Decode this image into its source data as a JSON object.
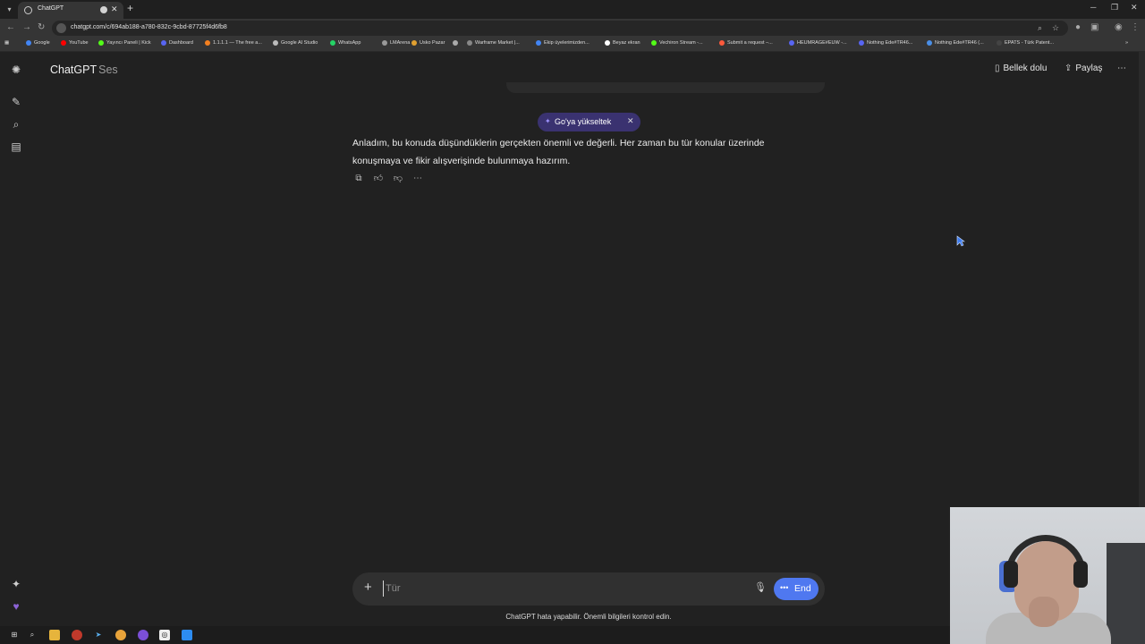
{
  "browser": {
    "tab_title": "ChatGPT",
    "url": "chatgpt.com/c/694ab188-a780-832c-9cbd-87725f4d6fb8",
    "bookmarks": [
      {
        "label": "Google",
        "color": "#4285f4"
      },
      {
        "label": "YouTube",
        "color": "#ff0000"
      },
      {
        "label": "Yayıncı Paneli | Kick",
        "color": "#53fc18"
      },
      {
        "label": "Dashboard",
        "color": "#5865f2"
      },
      {
        "label": "1.1.1.1 — The free a...",
        "color": "#f38020"
      },
      {
        "label": "Google AI Studio",
        "color": "#bbbbbb"
      },
      {
        "label": "WhatsApp",
        "color": "#25d366"
      },
      {
        "label": "LMArena",
        "color": "#999999"
      },
      {
        "label": "Usko Pazar",
        "color": "#e0a030"
      },
      {
        "label": "",
        "color": "#aaaaaa"
      },
      {
        "label": "Warframe Market |...",
        "color": "#888888"
      },
      {
        "label": "Ekip üyelerimizden...",
        "color": "#4285f4"
      },
      {
        "label": "Beyaz ekran",
        "color": "#ffffff"
      },
      {
        "label": "Vechiron Stream -...",
        "color": "#53fc18"
      },
      {
        "label": "Submit a request –...",
        "color": "#ff5a3c"
      },
      {
        "label": "HEUMRAGE#EUW -...",
        "color": "#5865f2"
      },
      {
        "label": "Nothing Ede#TR46...",
        "color": "#5865f2"
      },
      {
        "label": "Nothing Ede#TR46 (...",
        "color": "#4a8fe7"
      },
      {
        "label": "EPATS - Türk Patent...",
        "color": "#444444"
      }
    ]
  },
  "header": {
    "title": "ChatGPT",
    "mode": "Ses",
    "upgrade_label": "Go'ya yükseltek",
    "memory_label": "Bellek dolu",
    "share_label": "Paylaş"
  },
  "conversation": {
    "assistant_message": "Anladım, bu konuda düşündüklerin gerçekten önemli ve değerli. Her zaman bu tür konular üzerinde konuşmaya ve fikir alışverişinde bulunmaya hazırım."
  },
  "composer": {
    "placeholder": "Tür",
    "end_label": "End"
  },
  "footer": {
    "disclaimer": "ChatGPT hata yapabilir. Önemli bilgileri kontrol edin."
  },
  "colors": {
    "background": "#212121",
    "upgrade_pill": "#3a3270",
    "end_button": "#4f78f0"
  }
}
